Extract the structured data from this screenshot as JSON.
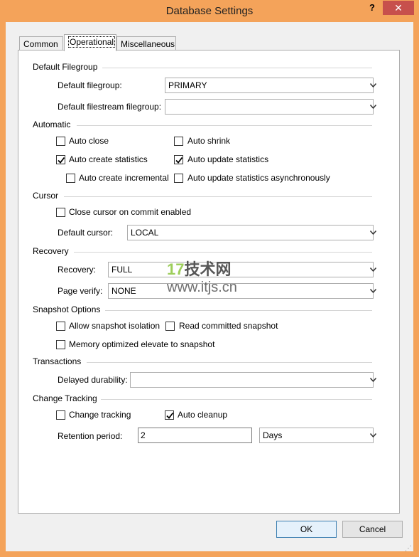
{
  "window": {
    "title": "Database Settings",
    "help": "?",
    "close": "✕"
  },
  "tabs": [
    {
      "label": "Common"
    },
    {
      "label": "Operational"
    },
    {
      "label": "Miscellaneous"
    }
  ],
  "groups": {
    "default_filegroup": "Default Filegroup",
    "automatic": "Automatic",
    "cursor": "Cursor",
    "recovery": "Recovery",
    "snapshot": "Snapshot Options",
    "transactions": "Transactions",
    "change_tracking": "Change Tracking"
  },
  "fields": {
    "default_filegroup_label": "Default filegroup:",
    "default_filegroup_value": "PRIMARY",
    "default_filestream_label": "Default filestream filegroup:",
    "default_filestream_value": "",
    "default_cursor_label": "Default cursor:",
    "default_cursor_value": "LOCAL",
    "recovery_label": "Recovery:",
    "recovery_value": "FULL",
    "page_verify_label": "Page verify:",
    "page_verify_value": "NONE",
    "delayed_durability_label": "Delayed durability:",
    "delayed_durability_value": "",
    "retention_label": "Retention period:",
    "retention_value": "2",
    "retention_unit": "Days"
  },
  "checkboxes": {
    "auto_close": {
      "label": "Auto close",
      "checked": false
    },
    "auto_shrink": {
      "label": "Auto shrink",
      "checked": false
    },
    "auto_create_stats": {
      "label": "Auto create statistics",
      "checked": true
    },
    "auto_update_stats": {
      "label": "Auto update statistics",
      "checked": true
    },
    "auto_create_incremental": {
      "label": "Auto create incremental",
      "checked": false
    },
    "auto_update_async": {
      "label": "Auto update statistics asynchronously",
      "checked": false
    },
    "close_cursor": {
      "label": "Close cursor on commit enabled",
      "checked": false
    },
    "allow_snapshot": {
      "label": "Allow snapshot isolation",
      "checked": false
    },
    "read_committed_snapshot": {
      "label": "Read committed snapshot",
      "checked": false
    },
    "memory_optimized": {
      "label": "Memory optimized elevate to snapshot",
      "checked": false
    },
    "change_tracking": {
      "label": "Change tracking",
      "checked": false
    },
    "auto_cleanup": {
      "label": "Auto cleanup",
      "checked": true
    }
  },
  "buttons": {
    "ok": "OK",
    "cancel": "Cancel"
  },
  "watermark": {
    "logo_num": "17",
    "logo_text": "技术网",
    "url": "www.itjs.cn"
  }
}
